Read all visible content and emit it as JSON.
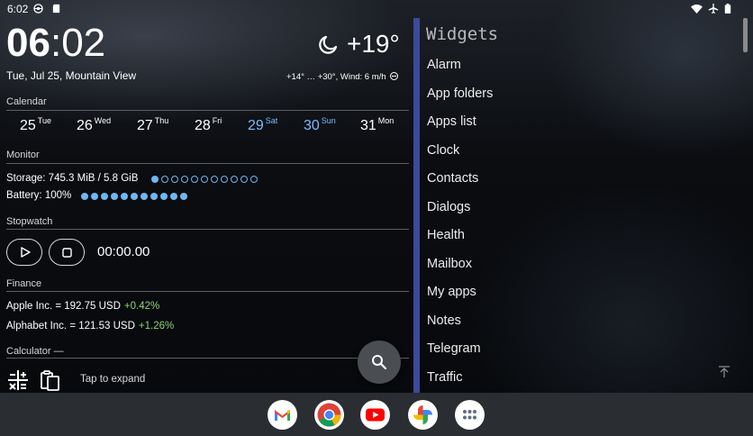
{
  "status_bar": {
    "time": "6:02",
    "icons": [
      "network-icon",
      "sd-card-icon",
      "wifi-icon",
      "airplane-icon",
      "battery-icon"
    ]
  },
  "clock": {
    "hour": "06",
    "separator": ":",
    "minute": "02"
  },
  "date_line": "Tue, Jul 25, Mountain View",
  "weather": {
    "icon": "moon-icon",
    "temperature": "+19°",
    "details": "+14° … +30°, Wind: 6 m/h"
  },
  "calendar": {
    "label": "Calendar",
    "days": [
      {
        "num": "25",
        "wd": "Tue",
        "weekend": false
      },
      {
        "num": "26",
        "wd": "Wed",
        "weekend": false
      },
      {
        "num": "27",
        "wd": "Thu",
        "weekend": false
      },
      {
        "num": "28",
        "wd": "Fri",
        "weekend": false
      },
      {
        "num": "29",
        "wd": "Sat",
        "weekend": true
      },
      {
        "num": "30",
        "wd": "Sun",
        "weekend": true
      },
      {
        "num": "31",
        "wd": "Mon",
        "weekend": false
      }
    ]
  },
  "monitor": {
    "label": "Monitor",
    "storage": {
      "text": "Storage: 745.3 MiB / 5.8 GiB",
      "filled": 1,
      "total": 11
    },
    "battery": {
      "text": "Battery: 100%",
      "filled": 11,
      "total": 11
    }
  },
  "stopwatch": {
    "label": "Stopwatch",
    "time": "00:00.00",
    "play_icon": "play-icon",
    "stop_icon": "stop-icon"
  },
  "finance": {
    "label": "Finance",
    "rows": [
      {
        "text": "Apple Inc. = 192.75 USD",
        "change": "+0.42%"
      },
      {
        "text": "Alphabet Inc. = 121.53 USD",
        "change": "+1.26%"
      }
    ]
  },
  "calculator": {
    "label": "Calculator —",
    "hint": "Tap to expand"
  },
  "search_fab_icon": "search-icon",
  "drawer": {
    "title": "Widgets",
    "items": [
      "Alarm",
      "App folders",
      "Apps list",
      "Clock",
      "Contacts",
      "Dialogs",
      "Health",
      "Mailbox",
      "My apps",
      "Notes",
      "Telegram",
      "Traffic"
    ],
    "scroll_top_icon": "arrow-up-icon"
  },
  "dock": {
    "apps": [
      "gmail-icon",
      "chrome-icon",
      "youtube-icon",
      "photos-icon",
      "app-drawer-icon"
    ]
  },
  "colors": {
    "accent_weekend": "#7bbcff",
    "dot": "#6fb7f2",
    "finance_up": "#8fd07a",
    "drawer_bar": "#3b4a9a",
    "dock": "#2a2d31"
  }
}
